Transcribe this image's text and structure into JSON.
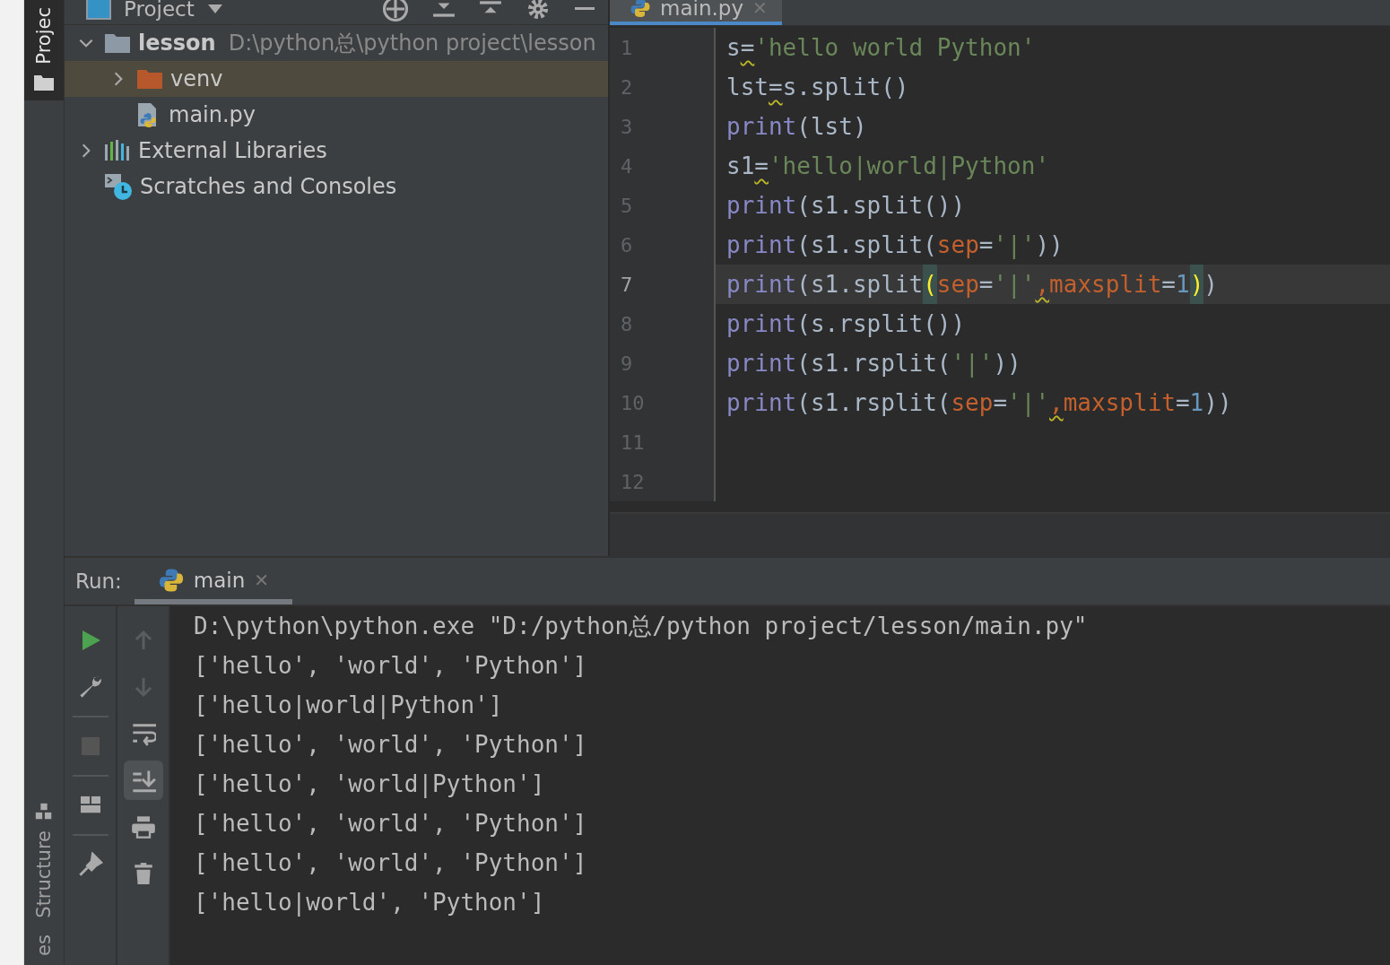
{
  "side_strip": {
    "tabs": [
      {
        "label": "Projec",
        "selected": true
      },
      {
        "label": "Structure",
        "selected": false
      },
      {
        "label": "es",
        "selected": false
      }
    ]
  },
  "project_panel": {
    "title": "Project",
    "tree": [
      {
        "label": "lesson",
        "path": "D:\\python总\\python project\\lesson",
        "kind": "folder",
        "expanded": true,
        "selected": false,
        "children": [
          {
            "label": "venv",
            "kind": "venv",
            "expanded": false,
            "selected": true
          },
          {
            "label": "main.py",
            "kind": "file",
            "selected": false
          }
        ]
      },
      {
        "label": "External Libraries",
        "kind": "libraries",
        "expanded": false,
        "selected": false
      },
      {
        "label": "Scratches and Consoles",
        "kind": "scratches",
        "selected": false
      }
    ]
  },
  "editor": {
    "tabs": [
      {
        "label": "main.py",
        "selected": true,
        "close": "✕"
      }
    ],
    "lines": [
      {
        "number": "1",
        "tokens": [
          {
            "text": "s",
            "kind": "plain"
          },
          {
            "text": "=",
            "kind": "plain",
            "warn": true
          },
          {
            "text": "'hello world Python'",
            "kind": "string"
          }
        ]
      },
      {
        "number": "2",
        "tokens": [
          {
            "text": "lst",
            "kind": "plain"
          },
          {
            "text": "=",
            "kind": "plain",
            "warn": true
          },
          {
            "text": "s.split()",
            "kind": "plain"
          }
        ]
      },
      {
        "number": "3",
        "tokens": [
          {
            "text": "print",
            "kind": "builtin"
          },
          {
            "text": "(lst)",
            "kind": "plain"
          }
        ]
      },
      {
        "number": "4",
        "tokens": [
          {
            "text": "s1",
            "kind": "plain"
          },
          {
            "text": "=",
            "kind": "plain",
            "warn": true
          },
          {
            "text": "'hello|world|Python'",
            "kind": "string"
          }
        ]
      },
      {
        "number": "5",
        "tokens": [
          {
            "text": "print",
            "kind": "builtin"
          },
          {
            "text": "(s1.split())",
            "kind": "plain"
          }
        ]
      },
      {
        "number": "6",
        "tokens": [
          {
            "text": "print",
            "kind": "builtin"
          },
          {
            "text": "(s1.split(",
            "kind": "plain"
          },
          {
            "text": "sep",
            "kind": "param"
          },
          {
            "text": "=",
            "kind": "plain"
          },
          {
            "text": "'|'",
            "kind": "string"
          },
          {
            "text": "))",
            "kind": "plain"
          }
        ]
      },
      {
        "number": "7",
        "current": true,
        "tokens": [
          {
            "text": "print",
            "kind": "builtin"
          },
          {
            "text": "(s1.split",
            "kind": "plain"
          },
          {
            "text": "(",
            "kind": "brace"
          },
          {
            "text": "sep",
            "kind": "param"
          },
          {
            "text": "=",
            "kind": "plain"
          },
          {
            "text": "'|'",
            "kind": "string"
          },
          {
            "text": ",",
            "kind": "param",
            "warn": true
          },
          {
            "text": "maxsplit",
            "kind": "param"
          },
          {
            "text": "=",
            "kind": "plain"
          },
          {
            "text": "1",
            "kind": "number"
          },
          {
            "text": ")",
            "kind": "brace"
          },
          {
            "text": ")",
            "kind": "plain"
          }
        ]
      },
      {
        "number": "8",
        "tokens": [
          {
            "text": "print",
            "kind": "builtin"
          },
          {
            "text": "(s.rsplit())",
            "kind": "plain"
          }
        ]
      },
      {
        "number": "9",
        "tokens": [
          {
            "text": "print",
            "kind": "builtin"
          },
          {
            "text": "(s1.rsplit(",
            "kind": "plain"
          },
          {
            "text": "'|'",
            "kind": "string"
          },
          {
            "text": "))",
            "kind": "plain"
          }
        ]
      },
      {
        "number": "10",
        "tokens": [
          {
            "text": "print",
            "kind": "builtin"
          },
          {
            "text": "(s1.rsplit(",
            "kind": "plain"
          },
          {
            "text": "sep",
            "kind": "param"
          },
          {
            "text": "=",
            "kind": "plain"
          },
          {
            "text": "'|'",
            "kind": "string"
          },
          {
            "text": ",",
            "kind": "param",
            "warn": true
          },
          {
            "text": "maxsplit",
            "kind": "param"
          },
          {
            "text": "=",
            "kind": "plain"
          },
          {
            "text": "1",
            "kind": "number"
          },
          {
            "text": "))",
            "kind": "plain"
          }
        ]
      },
      {
        "number": "11"
      },
      {
        "number": "12"
      }
    ]
  },
  "run_panel": {
    "label": "Run:",
    "tabs": [
      {
        "label": "main",
        "selected": true,
        "close": "✕"
      }
    ],
    "output": [
      "D:\\python\\python.exe \"D:/python总/python project/lesson/main.py\"",
      "['hello', 'world', 'Python']",
      "['hello|world|Python']",
      "['hello', 'world', 'Python']",
      "['hello', 'world|Python']",
      "['hello', 'world', 'Python']",
      "['hello', 'world', 'Python']",
      "['hello|world', 'Python']"
    ]
  }
}
